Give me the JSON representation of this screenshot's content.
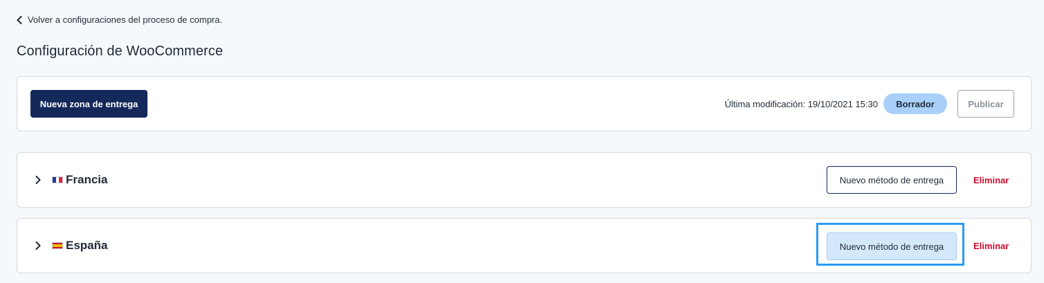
{
  "header": {
    "back_label": "Volver a configuraciones del proceso de compra.",
    "title": "Configuración de WooCommerce"
  },
  "toolbar": {
    "new_zone_label": "Nueva zona de entrega",
    "last_modified": "Última modificación: 19/10/2021 15:30",
    "status_badge": "Borrador",
    "publish_label": "Publicar"
  },
  "zones": [
    {
      "name": "Francia",
      "flag_icon": "france-flag-icon",
      "flag_colors": [
        "#1f3c9b",
        "#ffffff",
        "#e0283a"
      ],
      "new_method_label": "Nuevo método de entrega",
      "delete_label": "Eliminar"
    },
    {
      "name": "España",
      "flag_icon": "spain-flag-icon",
      "flag_colors": [
        "#c8102e",
        "#f2c200",
        "#c8102e"
      ],
      "new_method_label": "Nuevo método de entrega",
      "delete_label": "Eliminar",
      "highlighted": true
    }
  ],
  "colors": {
    "primary": "#14285a",
    "badge_bg": "#a8d0fa",
    "danger": "#c8102e",
    "focus": "#2b9af3",
    "page_bg": "#f6f9fc"
  }
}
